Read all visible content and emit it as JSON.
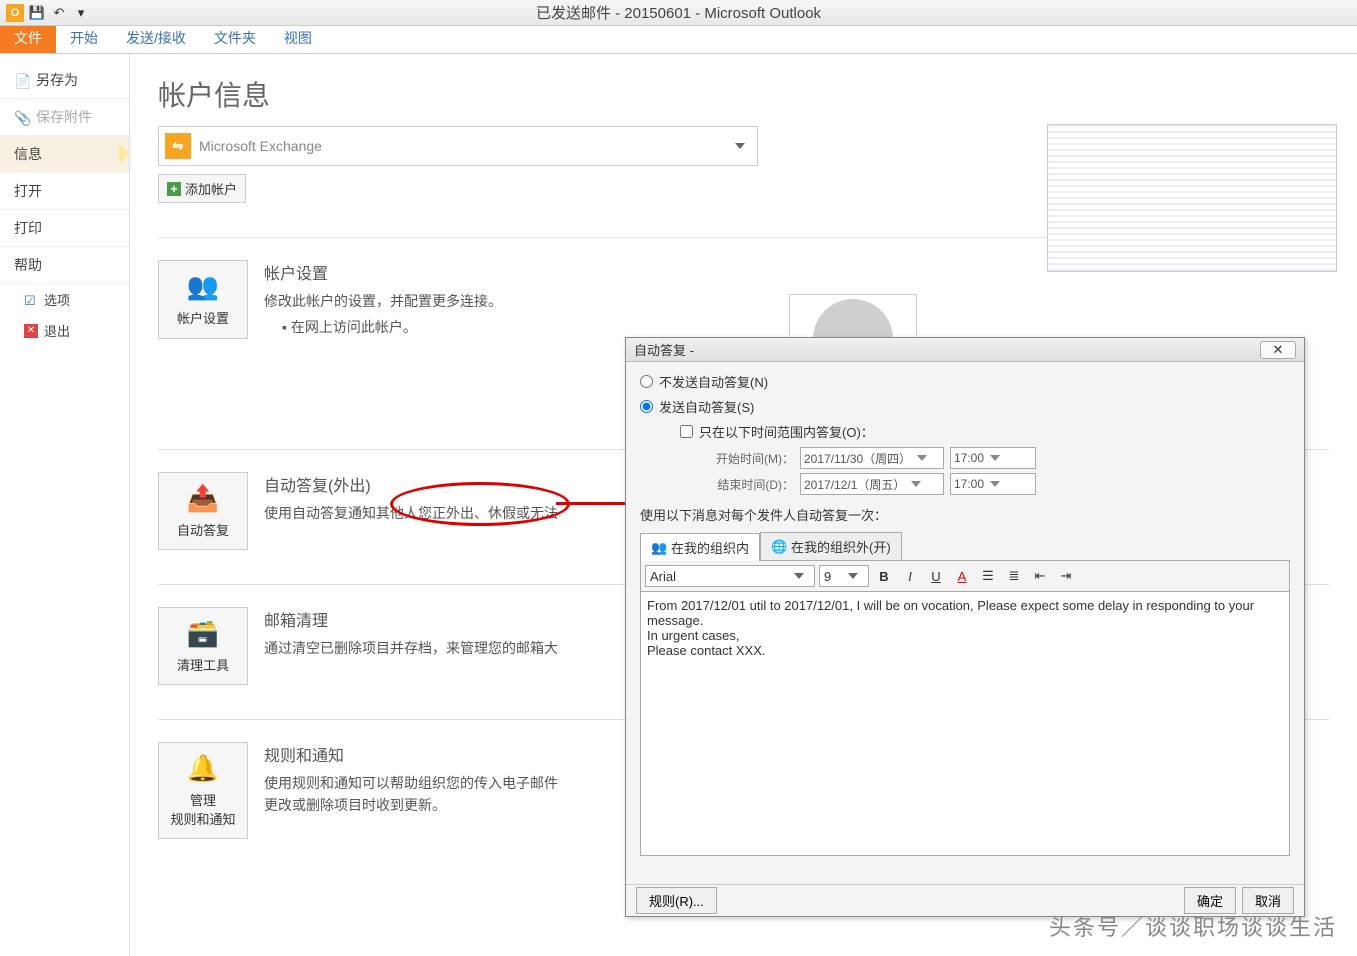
{
  "window": {
    "title": "已发送邮件 - 20150601 - Microsoft Outlook"
  },
  "ribbon": {
    "tabs": [
      "文件",
      "开始",
      "发送/接收",
      "文件夹",
      "视图"
    ]
  },
  "leftnav": {
    "save_as": "另存为",
    "save_attachments": "保存附件",
    "info": "信息",
    "open": "打开",
    "print": "打印",
    "help": "帮助",
    "options": "选项",
    "exit": "退出"
  },
  "content": {
    "page_title": "帐户信息",
    "account_name": "Microsoft Exchange",
    "add_account": "添加帐户",
    "account_settings": {
      "heading": "帐户设置",
      "desc": "修改此帐户的设置，并配置更多连接。",
      "bullet": "在网上访问此帐户。",
      "btn": "帐户设置"
    },
    "auto_reply": {
      "heading": "自动答复(外出)",
      "desc": "使用自动答复通知其他人您正外出、休假或无法",
      "btn": "自动答复"
    },
    "cleanup": {
      "heading": "邮箱清理",
      "desc": "通过清空已删除项目并存档，来管理您的邮箱大",
      "btn": "清理工具"
    },
    "rules": {
      "heading": "规则和通知",
      "desc1": "使用规则和通知可以帮助组织您的传入电子邮件",
      "desc2": "更改或删除项目时收到更新。",
      "btn": "管理\n规则和通知"
    }
  },
  "dialog": {
    "title": "自动答复 - ",
    "radio_no_send": "不发送自动答复(N)",
    "radio_send": "发送自动答复(S)",
    "check_time": "只在以下时间范围内答复(O)：",
    "start_label": "开始时间(M)：",
    "start_date": "2017/11/30（周四）",
    "start_time": "17:00",
    "end_label": "结束时间(D)：",
    "end_date": "2017/12/1（周五）",
    "end_time": "17:00",
    "use_label": "使用以下消息对每个发件人自动答复一次：",
    "tab_inside": "在我的组织内",
    "tab_outside": "在我的组织外(开)",
    "font_name": "Arial",
    "font_size": "9",
    "editor_text": "From 2017/12/01 util to 2017/12/01, I will be on vocation, Please expect some delay in responding to your message.\nIn urgent cases,\nPlease contact XXX.",
    "rules_btn": "规则(R)...",
    "ok_btn": "确定",
    "cancel_btn": "取消"
  },
  "watermark": "头条号／谈谈职场谈谈生活"
}
